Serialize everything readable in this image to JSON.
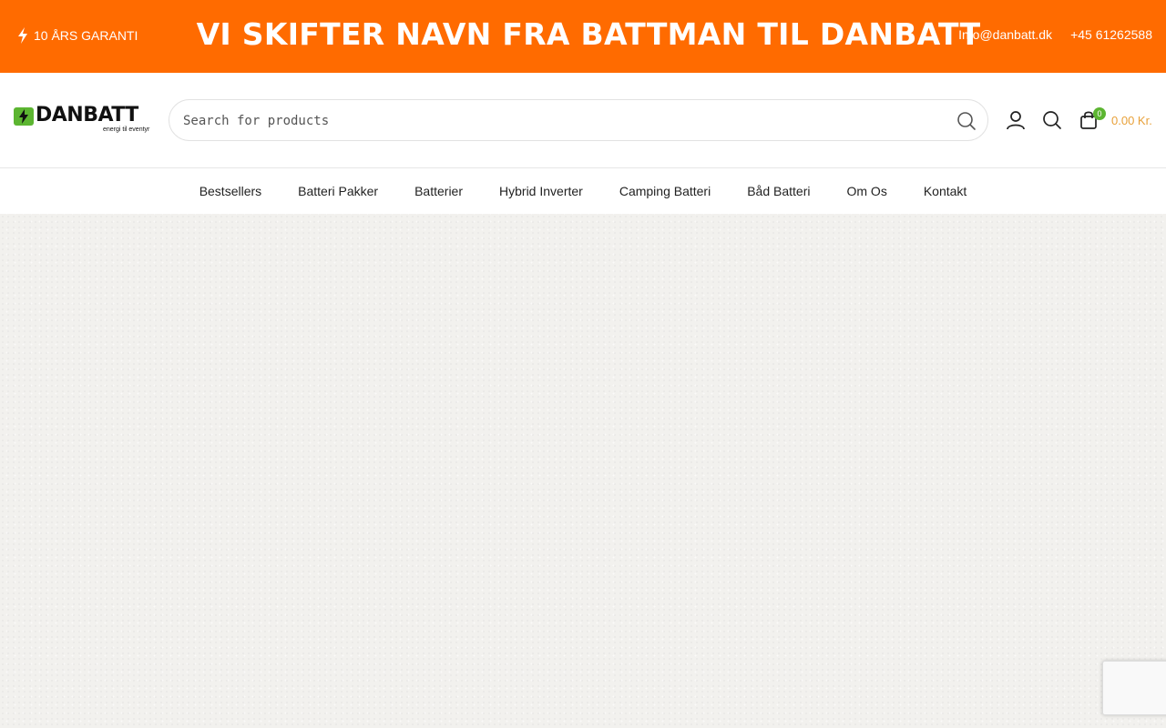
{
  "topbar": {
    "guarantee_text": "10 ÅRS GARANTI",
    "headline": "VI SKIFTER NAVN FRA BATTMAN TIL DANBATT",
    "email": "Info@danbatt.dk",
    "phone": "+45 61262588",
    "background_color": "#ff6b00"
  },
  "header": {
    "logo_text": "DANBATT",
    "logo_tagline": "energi til eventyr",
    "search_placeholder": "Search for products",
    "cart_count": "0",
    "cart_total": "0.00 Kr.",
    "brand_green": "#5cb531",
    "price_color": "#e8a13a",
    "icons": [
      "search-icon",
      "user-icon",
      "search-icon",
      "shopping-bag-icon"
    ]
  },
  "nav": {
    "items": [
      "Bestsellers",
      "Batteri Pakker",
      "Batterier",
      "Hybrid Inverter",
      "Camping Batteri",
      "Båd Batteri",
      "Om Os",
      "Kontakt"
    ]
  }
}
